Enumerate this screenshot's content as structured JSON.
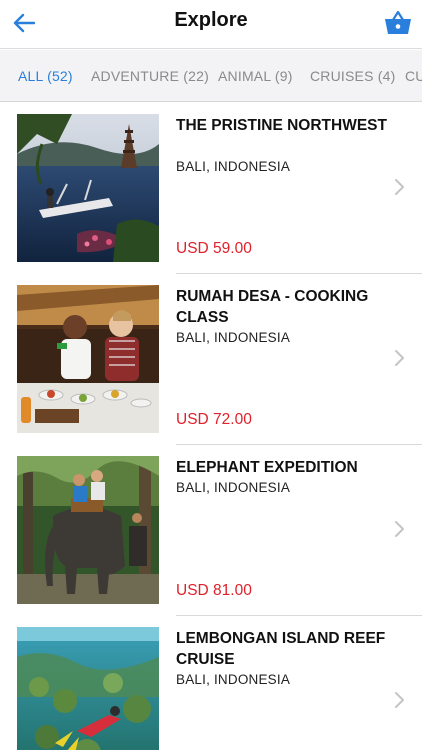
{
  "header": {
    "title": "Explore",
    "accent_color": "#2a7fdc",
    "back_icon": "arrow-left-icon",
    "cart_icon": "basket-icon"
  },
  "tabs": [
    {
      "label": "ALL (52)",
      "active": true
    },
    {
      "label": "ADVENTURE (22)",
      "active": false
    },
    {
      "label": "ANIMAL (9)",
      "active": false
    },
    {
      "label": "CRUISES (4)",
      "active": false
    },
    {
      "label": "CU",
      "active": false
    }
  ],
  "items": [
    {
      "name": "THE PRISTINE NORTHWEST",
      "location": "BALI, INDONESIA",
      "price": "USD 59.00"
    },
    {
      "name": "RUMAH DESA - COOKING CLASS",
      "location": "BALI, INDONESIA",
      "price": "USD 72.00"
    },
    {
      "name": "ELEPHANT EXPEDITION",
      "location": "BALI, INDONESIA",
      "price": "USD 81.00"
    },
    {
      "name": "LEMBONGAN ISLAND REEF CRUISE",
      "location": "BALI, INDONESIA",
      "price": ""
    }
  ],
  "colors": {
    "price": "#e0202a",
    "active_tab": "#2a7fdc",
    "inactive_tab": "#8a8a8a",
    "tab_bar_bg": "#f3f3f5"
  }
}
